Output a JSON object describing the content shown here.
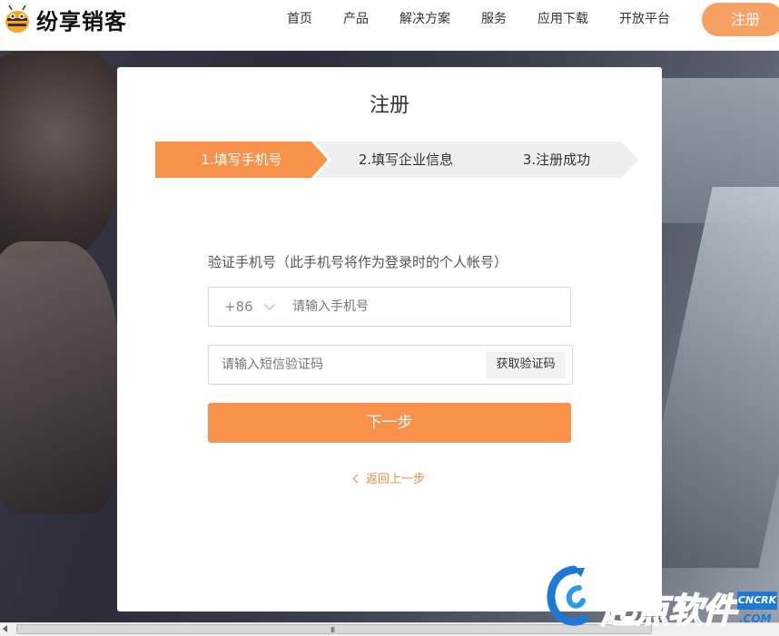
{
  "header": {
    "brand": "纷享销客",
    "nav": [
      "首页",
      "产品",
      "解决方案",
      "服务",
      "应用下载",
      "开放平台"
    ],
    "register_label": "注册",
    "accent": "#f8914a"
  },
  "card": {
    "title": "注册",
    "steps": [
      "1.填写手机号",
      "2.填写企业信息",
      "3.注册成功"
    ],
    "active_step": 1,
    "phone_label": "验证手机号（此手机号将作为登录时的个人帐号）",
    "country_code": "+86",
    "phone_placeholder": "请输入手机号",
    "code_placeholder": "请输入短信验证码",
    "get_code_label": "获取验证码",
    "next_label": "下一步",
    "back_label": "返回上一步"
  },
  "scrollbar": {
    "grip": "III"
  },
  "watermark": {
    "text": "起点软件",
    "tag": "CNCRK",
    "com": ".COM"
  },
  "icons": [
    "logo-bee-icon",
    "chevron-down-icon",
    "chevron-left-icon",
    "scroll-left-arrow-icon"
  ]
}
